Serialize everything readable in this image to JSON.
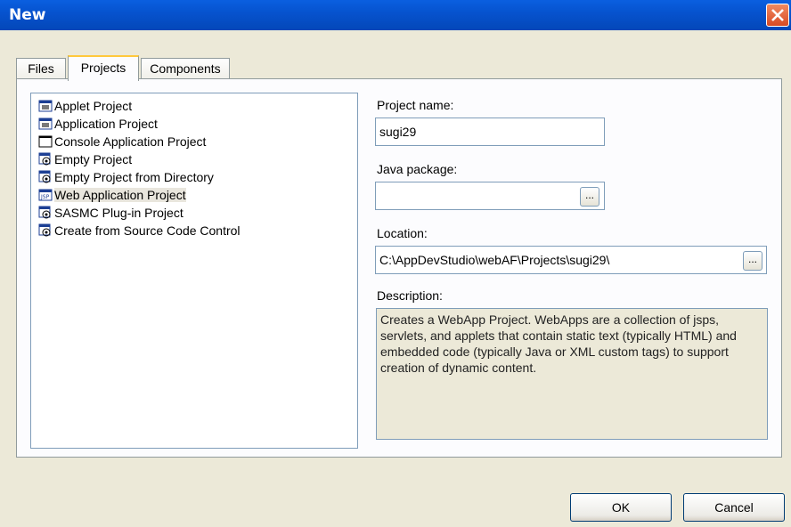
{
  "window": {
    "title": "New"
  },
  "tabs": [
    {
      "label": "Files"
    },
    {
      "label": "Projects"
    },
    {
      "label": "Components"
    }
  ],
  "project_list": [
    {
      "label": "Applet Project",
      "icon": "applet-project-icon"
    },
    {
      "label": "Application Project",
      "icon": "application-project-icon"
    },
    {
      "label": "Console Application Project",
      "icon": "console-window-icon"
    },
    {
      "label": "Empty Project",
      "icon": "empty-project-icon"
    },
    {
      "label": "Empty Project from Directory",
      "icon": "empty-project-icon"
    },
    {
      "label": "Web Application Project",
      "icon": "web-application-icon"
    },
    {
      "label": "SASMC Plug-in Project",
      "icon": "plugin-project-icon"
    },
    {
      "label": "Create from Source Code Control",
      "icon": "source-control-icon"
    }
  ],
  "form": {
    "project_name_label": "Project name:",
    "project_name_value": "sugi29",
    "java_package_label": "Java package:",
    "java_package_value": "",
    "location_label": "Location:",
    "location_value": "C:\\AppDevStudio\\webAF\\Projects\\sugi29\\",
    "browse_label": "...",
    "description_label": "Description:",
    "description_text": "Creates a  WebApp Project.  WebApps are a collection of jsps, servlets, and applets that contain static text (typically HTML) and embedded code (typically Java or XML custom tags) to support creation of dynamic content."
  },
  "buttons": {
    "ok": "OK",
    "cancel": "Cancel"
  }
}
